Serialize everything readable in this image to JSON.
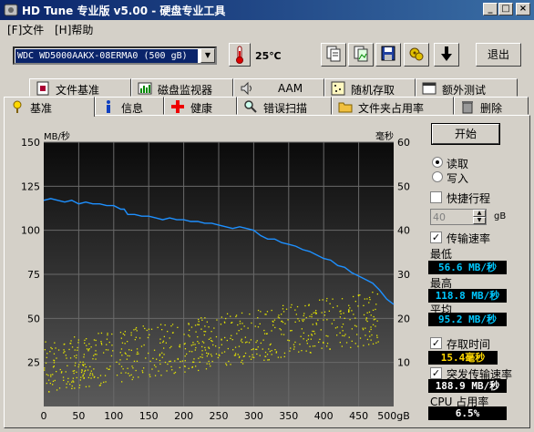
{
  "window": {
    "title": "HD Tune 专业版 v5.00 - 硬盘专业工具",
    "minimize": "_",
    "restore": "□",
    "close": "×"
  },
  "menu": {
    "file": "[F]文件",
    "help": "[H]帮助"
  },
  "toolbar": {
    "drive": "WDC WD5000AAKX-08ERMA0 (500 gB)",
    "temperature": "25℃",
    "exit_label": "退出",
    "buttons": [
      "copy-text-icon",
      "copy-image-icon",
      "save-icon",
      "options-icon",
      "down-arrow-icon"
    ]
  },
  "tabs_top": [
    {
      "label": "文件基准",
      "icon": "file-benchmark-icon"
    },
    {
      "label": "磁盘监视器",
      "icon": "disk-monitor-icon"
    },
    {
      "label": "AAM",
      "icon": "speaker-icon"
    },
    {
      "label": "随机存取",
      "icon": "random-access-icon"
    },
    {
      "label": "额外测试",
      "icon": "extra-tests-icon"
    }
  ],
  "tabs_bottom": [
    {
      "label": "基准",
      "icon": "benchmark-icon"
    },
    {
      "label": "信息",
      "icon": "info-icon"
    },
    {
      "label": "健康",
      "icon": "health-icon"
    },
    {
      "label": "错误扫描",
      "icon": "error-scan-icon"
    },
    {
      "label": "文件夹占用率",
      "icon": "folder-usage-icon"
    },
    {
      "label": "删除",
      "icon": "erase-icon"
    }
  ],
  "controls": {
    "start": "开始",
    "read": "读取",
    "write": "写入",
    "short_stroke": "快捷行程",
    "short_stroke_value": "40",
    "short_stroke_unit": "gB",
    "transfer_rate": "传输速率",
    "min_label": "最低",
    "min_value": "56.6 MB/秒",
    "max_label": "最高",
    "max_value": "118.8 MB/秒",
    "avg_label": "平均",
    "avg_value": "95.2 MB/秒",
    "access_time": "存取时间",
    "access_value": "15.4毫秒",
    "burst": "突发传输速率",
    "burst_value": "188.9 MB/秒",
    "cpu_label": "CPU 占用率",
    "cpu_value": "6.5%"
  },
  "chart_data": {
    "type": "line",
    "left_axis_label": "MB/秒",
    "right_axis_label": "毫秒",
    "y_left": [
      0,
      25,
      50,
      75,
      100,
      125,
      150
    ],
    "y_right": [
      0,
      10,
      20,
      30,
      40,
      50,
      60
    ],
    "x_ticks": [
      0,
      50,
      100,
      150,
      200,
      250,
      300,
      350,
      400,
      450
    ],
    "x_end_label": "500gB",
    "xlim": [
      0,
      500
    ],
    "ylim_left": [
      0,
      150
    ],
    "ylim_right": [
      0,
      60
    ],
    "series": [
      {
        "color": "#1e90ff",
        "x": [
          0,
          10,
          20,
          30,
          40,
          50,
          60,
          70,
          80,
          90,
          100,
          110,
          115,
          120,
          130,
          140,
          150,
          160,
          170,
          180,
          190,
          200,
          210,
          220,
          230,
          240,
          250,
          260,
          270,
          280,
          290,
          300,
          310,
          320,
          330,
          340,
          350,
          360,
          370,
          380,
          390,
          400,
          410,
          420,
          430,
          440,
          450,
          460,
          470,
          480,
          490,
          500
        ],
        "y": [
          117,
          118,
          117,
          116,
          117,
          115,
          116,
          115,
          115,
          114,
          114,
          112,
          112,
          109,
          109,
          108,
          108,
          107,
          106,
          107,
          106,
          106,
          105,
          105,
          104,
          104,
          103,
          102,
          101,
          102,
          101,
          100,
          97,
          95,
          95,
          93,
          92,
          91,
          89,
          88,
          86,
          84,
          83,
          80,
          79,
          76,
          74,
          72,
          70,
          66,
          61,
          58
        ]
      }
    ],
    "scatter_color": "#e6e600"
  }
}
